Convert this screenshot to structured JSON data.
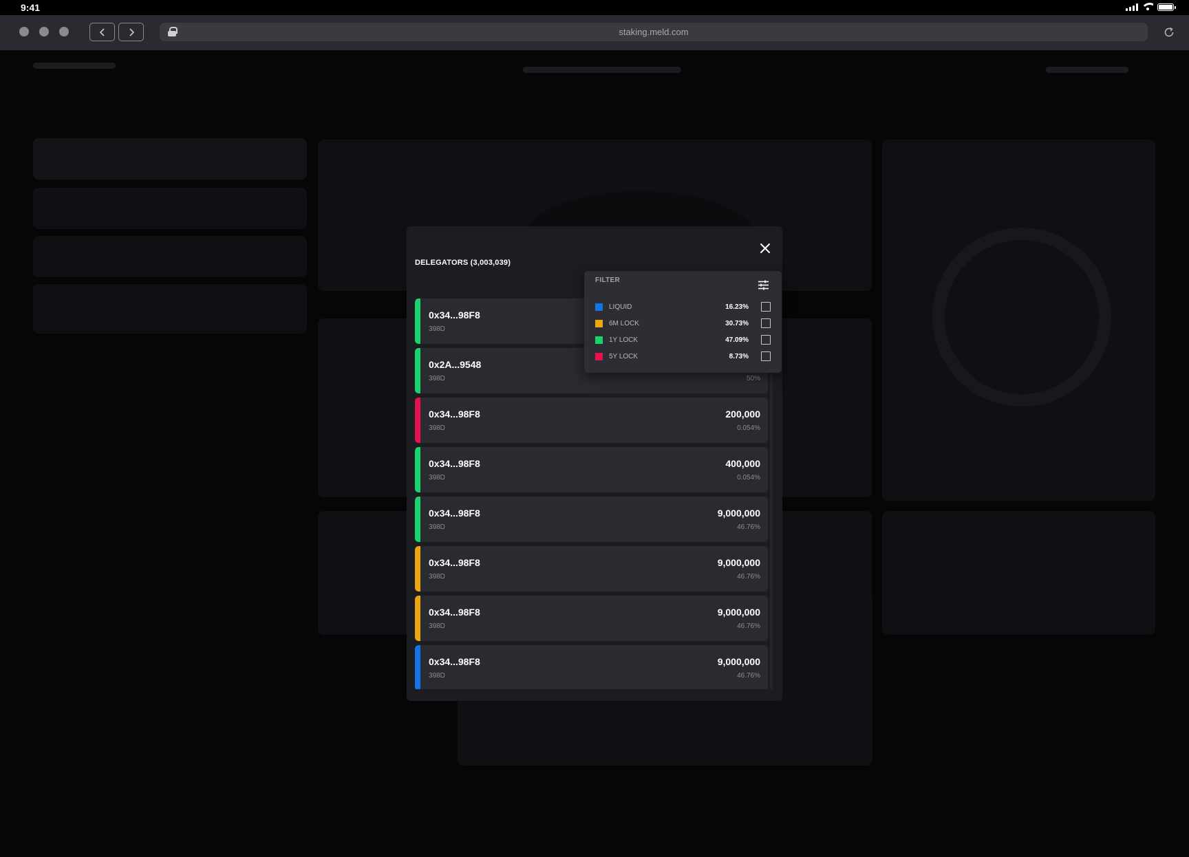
{
  "status_bar": {
    "time": "9:41"
  },
  "browser": {
    "url": "staking.meld.com"
  },
  "modal": {
    "title": "DELEGATORS (3,003,039)",
    "delegators": [
      {
        "address": "0x34...98F8",
        "duration": "398D",
        "amount": "",
        "percent": "",
        "color": "#16d46b"
      },
      {
        "address": "0x2A...9548",
        "duration": "398D",
        "amount": "",
        "percent": "50%",
        "color": "#16d46b"
      },
      {
        "address": "0x34...98F8",
        "duration": "398D",
        "amount": "200,000",
        "percent": "0.054%",
        "color": "#e5124f"
      },
      {
        "address": "0x34...98F8",
        "duration": "398D",
        "amount": "400,000",
        "percent": "0.054%",
        "color": "#16d46b"
      },
      {
        "address": "0x34...98F8",
        "duration": "398D",
        "amount": "9,000,000",
        "percent": "46.76%",
        "color": "#16d46b"
      },
      {
        "address": "0x34...98F8",
        "duration": "398D",
        "amount": "9,000,000",
        "percent": "46.76%",
        "color": "#eba70f"
      },
      {
        "address": "0x34...98F8",
        "duration": "398D",
        "amount": "9,000,000",
        "percent": "46.76%",
        "color": "#eba70f"
      },
      {
        "address": "0x34...98F8",
        "duration": "398D",
        "amount": "9,000,000",
        "percent": "46.76%",
        "color": "#1574e5"
      }
    ]
  },
  "filter": {
    "title": "FILTER",
    "options": [
      {
        "label": "LIQUID",
        "percent": "16.23%",
        "color": "#1574e5"
      },
      {
        "label": "6M LOCK",
        "percent": "30.73%",
        "color": "#eba70f"
      },
      {
        "label": "1Y LOCK",
        "percent": "47.09%",
        "color": "#16d46b"
      },
      {
        "label": "5Y LOCK",
        "percent": "8.73%",
        "color": "#e5124f"
      }
    ]
  },
  "icons": {
    "close": "close-icon",
    "filter_settings": "sliders-icon",
    "back": "chevron-left-icon",
    "forward": "chevron-right-icon",
    "reload": "reload-icon",
    "lock": "lock-icon"
  }
}
